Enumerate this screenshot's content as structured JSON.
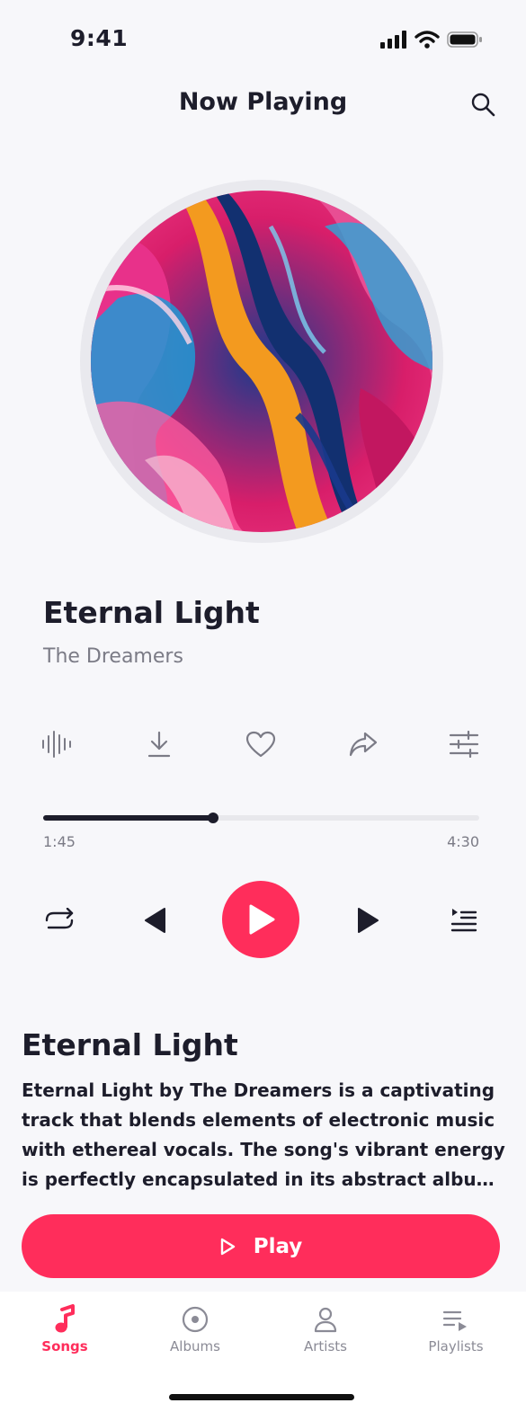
{
  "status_bar": {
    "time": "9:41",
    "icons": [
      "signal-icon",
      "wifi-icon",
      "battery-icon"
    ]
  },
  "header": {
    "title": "Now Playing",
    "search_icon": "search-icon"
  },
  "track": {
    "title": "Eternal Light",
    "artist": "The Dreamers"
  },
  "actions": [
    "waveform-icon",
    "download-icon",
    "heart-icon",
    "share-icon",
    "equalizer-icon"
  ],
  "progress": {
    "current": "1:45",
    "total": "4:30",
    "fraction": 0.389
  },
  "controls": [
    "repeat-icon",
    "previous-icon",
    "play-icon",
    "next-icon",
    "queue-icon"
  ],
  "about": {
    "title": "Eternal Light",
    "description": "Eternal Light by The Dreamers is a captivating track that blends elements of electronic music with ethereal vocals. The song's vibrant energy is perfectly encapsulated in its abstract album cover..."
  },
  "play_button": {
    "label": "Play"
  },
  "tabs": [
    {
      "label": "Songs",
      "icon": "music-note-icon",
      "active": true
    },
    {
      "label": "Albums",
      "icon": "disc-icon",
      "active": false
    },
    {
      "label": "Artists",
      "icon": "person-icon",
      "active": false
    },
    {
      "label": "Playlists",
      "icon": "playlist-icon",
      "active": false
    }
  ],
  "colors": {
    "accent": "#ff2d5b",
    "text": "#1d1d2b",
    "muted": "#7b7b86",
    "background": "#f7f7fa"
  }
}
